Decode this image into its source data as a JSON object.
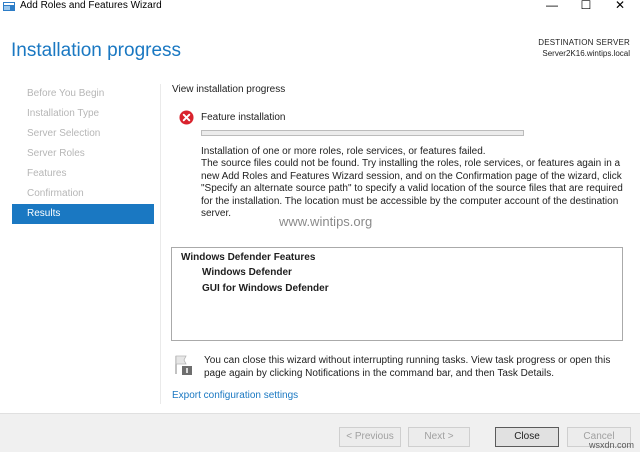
{
  "window": {
    "title": "Add Roles and Features Wizard",
    "minimize_glyph": "—",
    "maximize_glyph": "☐",
    "close_glyph": "✕"
  },
  "header": {
    "page_title": "Installation progress",
    "destination_label": "DESTINATION SERVER",
    "destination_value": "Server2K16.wintips.local"
  },
  "nav": {
    "items": [
      {
        "label": "Before You Begin",
        "active": false
      },
      {
        "label": "Installation Type",
        "active": false
      },
      {
        "label": "Server Selection",
        "active": false
      },
      {
        "label": "Server Roles",
        "active": false
      },
      {
        "label": "Features",
        "active": false
      },
      {
        "label": "Confirmation",
        "active": false
      },
      {
        "label": "Results",
        "active": true
      }
    ],
    "active_color": "#1a78c2"
  },
  "main": {
    "heading": "View installation progress",
    "feature_label": "Feature installation",
    "progress_fraction": 0,
    "message_lines": [
      "Installation of one or more roles, role services, or features failed.",
      "The source files could not be found. Try installing the roles, role services, or features again in a new Add Roles and Features Wizard session, and on the Confirmation page of the wizard, click \"Specify an alternate source path\" to specify a valid location of the source files that are required for the installation. The location must be accessible by the computer account of the destination server."
    ],
    "results": [
      "Windows Defender Features",
      "Windows Defender",
      "GUI for Windows Defender"
    ],
    "info_text": "You can close this wizard without interrupting running tasks. View task progress or open this page again by clicking Notifications in the command bar, and then Task Details.",
    "export_link": "Export configuration settings",
    "watermark": "www.wintips.org"
  },
  "footer": {
    "previous_label": "< Previous",
    "next_label": "Next >",
    "close_label": "Close",
    "cancel_label": "Cancel",
    "site_mark": "wsxdn.com"
  },
  "colors": {
    "accent": "#1a78c2",
    "error": "#d9232d"
  }
}
